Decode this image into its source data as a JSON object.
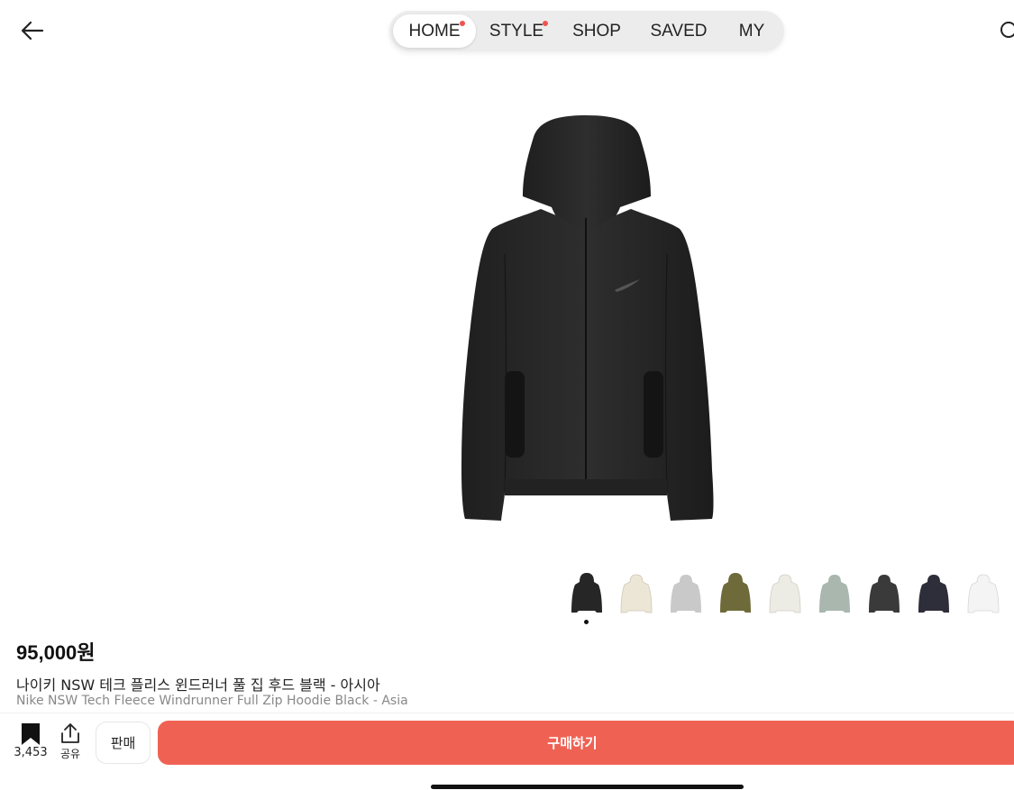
{
  "colors": {
    "accent": "#ef6253",
    "notification_dot": "#ef5350",
    "hoodie_black": "#2a2a2a",
    "thumb_colors": [
      "#262626",
      "#ece6d6",
      "#c9c9c9",
      "#6f6a3a",
      "#ecece4",
      "#a9b7ae",
      "#3a3a3a",
      "#2e2d3a",
      "#f4f4f4"
    ],
    "home_indicator": "#111111",
    "pager_dot": "#111111"
  },
  "header": {
    "back_icon": "arrow-left-icon",
    "search_icon": "search-icon"
  },
  "nav": {
    "tabs": [
      {
        "label": "HOME",
        "active": true,
        "has_dot": true
      },
      {
        "label": "STYLE",
        "active": false,
        "has_dot": true
      },
      {
        "label": "SHOP",
        "active": false,
        "has_dot": false
      },
      {
        "label": "SAVED",
        "active": false,
        "has_dot": false
      },
      {
        "label": "MY",
        "active": false,
        "has_dot": false
      }
    ]
  },
  "product": {
    "price": "95,000원",
    "title_ko": "나이키 NSW 테크 플리스 윈드러너 풀 집 후드 블랙 - 아시아",
    "title_en": "Nike NSW Tech Fleece Windrunner Full Zip Hoodie Black - Asia",
    "image_icon": "hoodie-image",
    "thumbnail_count": 9,
    "selected_thumbnail": 1
  },
  "bottom_bar": {
    "bookmark_count": "3,453",
    "bookmark_icon": "bookmark-icon",
    "share_label": "공유",
    "share_icon": "share-icon",
    "sell_label": "판매",
    "buy_label": "구매하기"
  }
}
